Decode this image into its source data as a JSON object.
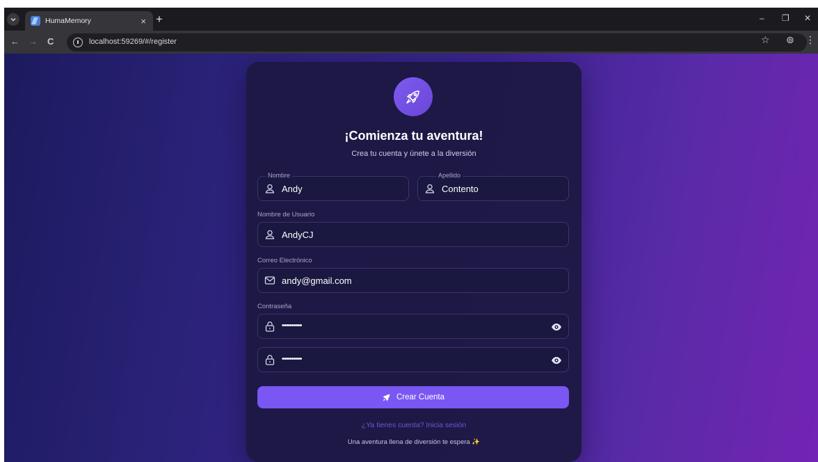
{
  "browser": {
    "tab_title": "HumaMemory",
    "tab_close": "×",
    "new_tab": "+",
    "url": "localhost:59269/#/register",
    "back": "←",
    "forward": "→",
    "reload": "C",
    "star": "☆",
    "profile": "⊚",
    "menu": "⋮",
    "minimize": "–",
    "restore": "❐",
    "close": "✕"
  },
  "form": {
    "heading": "¡Comienza tu aventura!",
    "subheading": "Crea tu cuenta y únete a la diversión",
    "first_name_label": "Nombre",
    "first_name_value": "Andy",
    "last_name_label": "Apellido",
    "last_name_value": "Contento",
    "username_label": "Nombre de Usuario",
    "username_value": "AndyCJ",
    "email_label": "Correo Electrónico",
    "email_value": "andy@gmail.com",
    "password_label": "Contraseña",
    "password_value": "••••••••••",
    "confirm_password_value": "••••••••••",
    "submit_label": "Crear Cuenta",
    "login_link": "¿Ya tienes cuenta? Inicia sesión",
    "tagline": "Una aventura llena de diversión te espera ✨"
  },
  "colors": {
    "accent": "#7a56f2",
    "card": "#1c1842",
    "link": "#6f57d6"
  }
}
